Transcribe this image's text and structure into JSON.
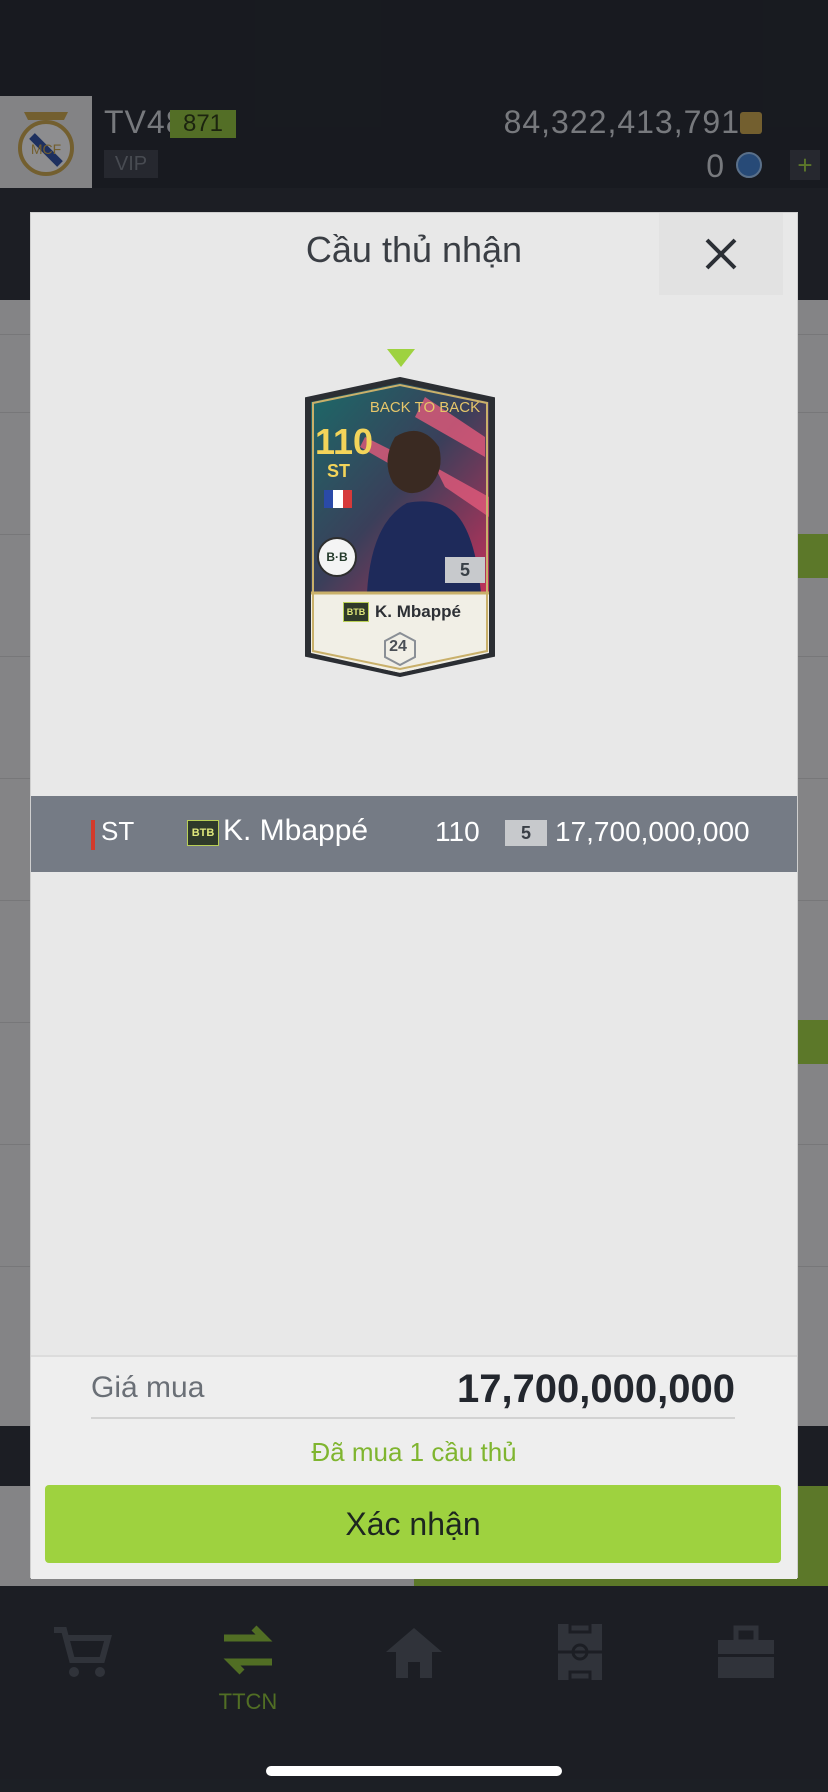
{
  "header": {
    "user_name": "TV48",
    "level": "871",
    "vip_label": "VIP",
    "coins": "84,322,413,791",
    "gems": "0",
    "plus_label": "+"
  },
  "bottom_nav": {
    "items": [
      {
        "name": "shop",
        "label": ""
      },
      {
        "name": "transfer",
        "label": "TTCN"
      },
      {
        "name": "home",
        "label": ""
      },
      {
        "name": "squad",
        "label": ""
      },
      {
        "name": "inventory",
        "label": ""
      }
    ]
  },
  "modal": {
    "title": "Cầu thủ nhận",
    "card": {
      "program": "BACK TO BACK",
      "ovr": "110",
      "position": "ST",
      "club_badge": "B·B",
      "grade": "5",
      "season_tag": "BTB",
      "name": "K. Mbappé",
      "season_number": "24"
    },
    "row": {
      "position": "ST",
      "season_tag": "BTB",
      "name": "K. Mbappé",
      "ovr": "110",
      "grade": "5",
      "price": "17,700,000,000"
    },
    "price_label": "Giá mua",
    "price_value": "17,700,000,000",
    "status": "Đã mua 1 cầu thủ",
    "confirm_label": "Xác nhận"
  },
  "colors": {
    "accent_green": "#9ed23f",
    "dark_bg": "#2a2f36",
    "row_bg": "#757b85",
    "position_mark": "#d33a2b"
  }
}
